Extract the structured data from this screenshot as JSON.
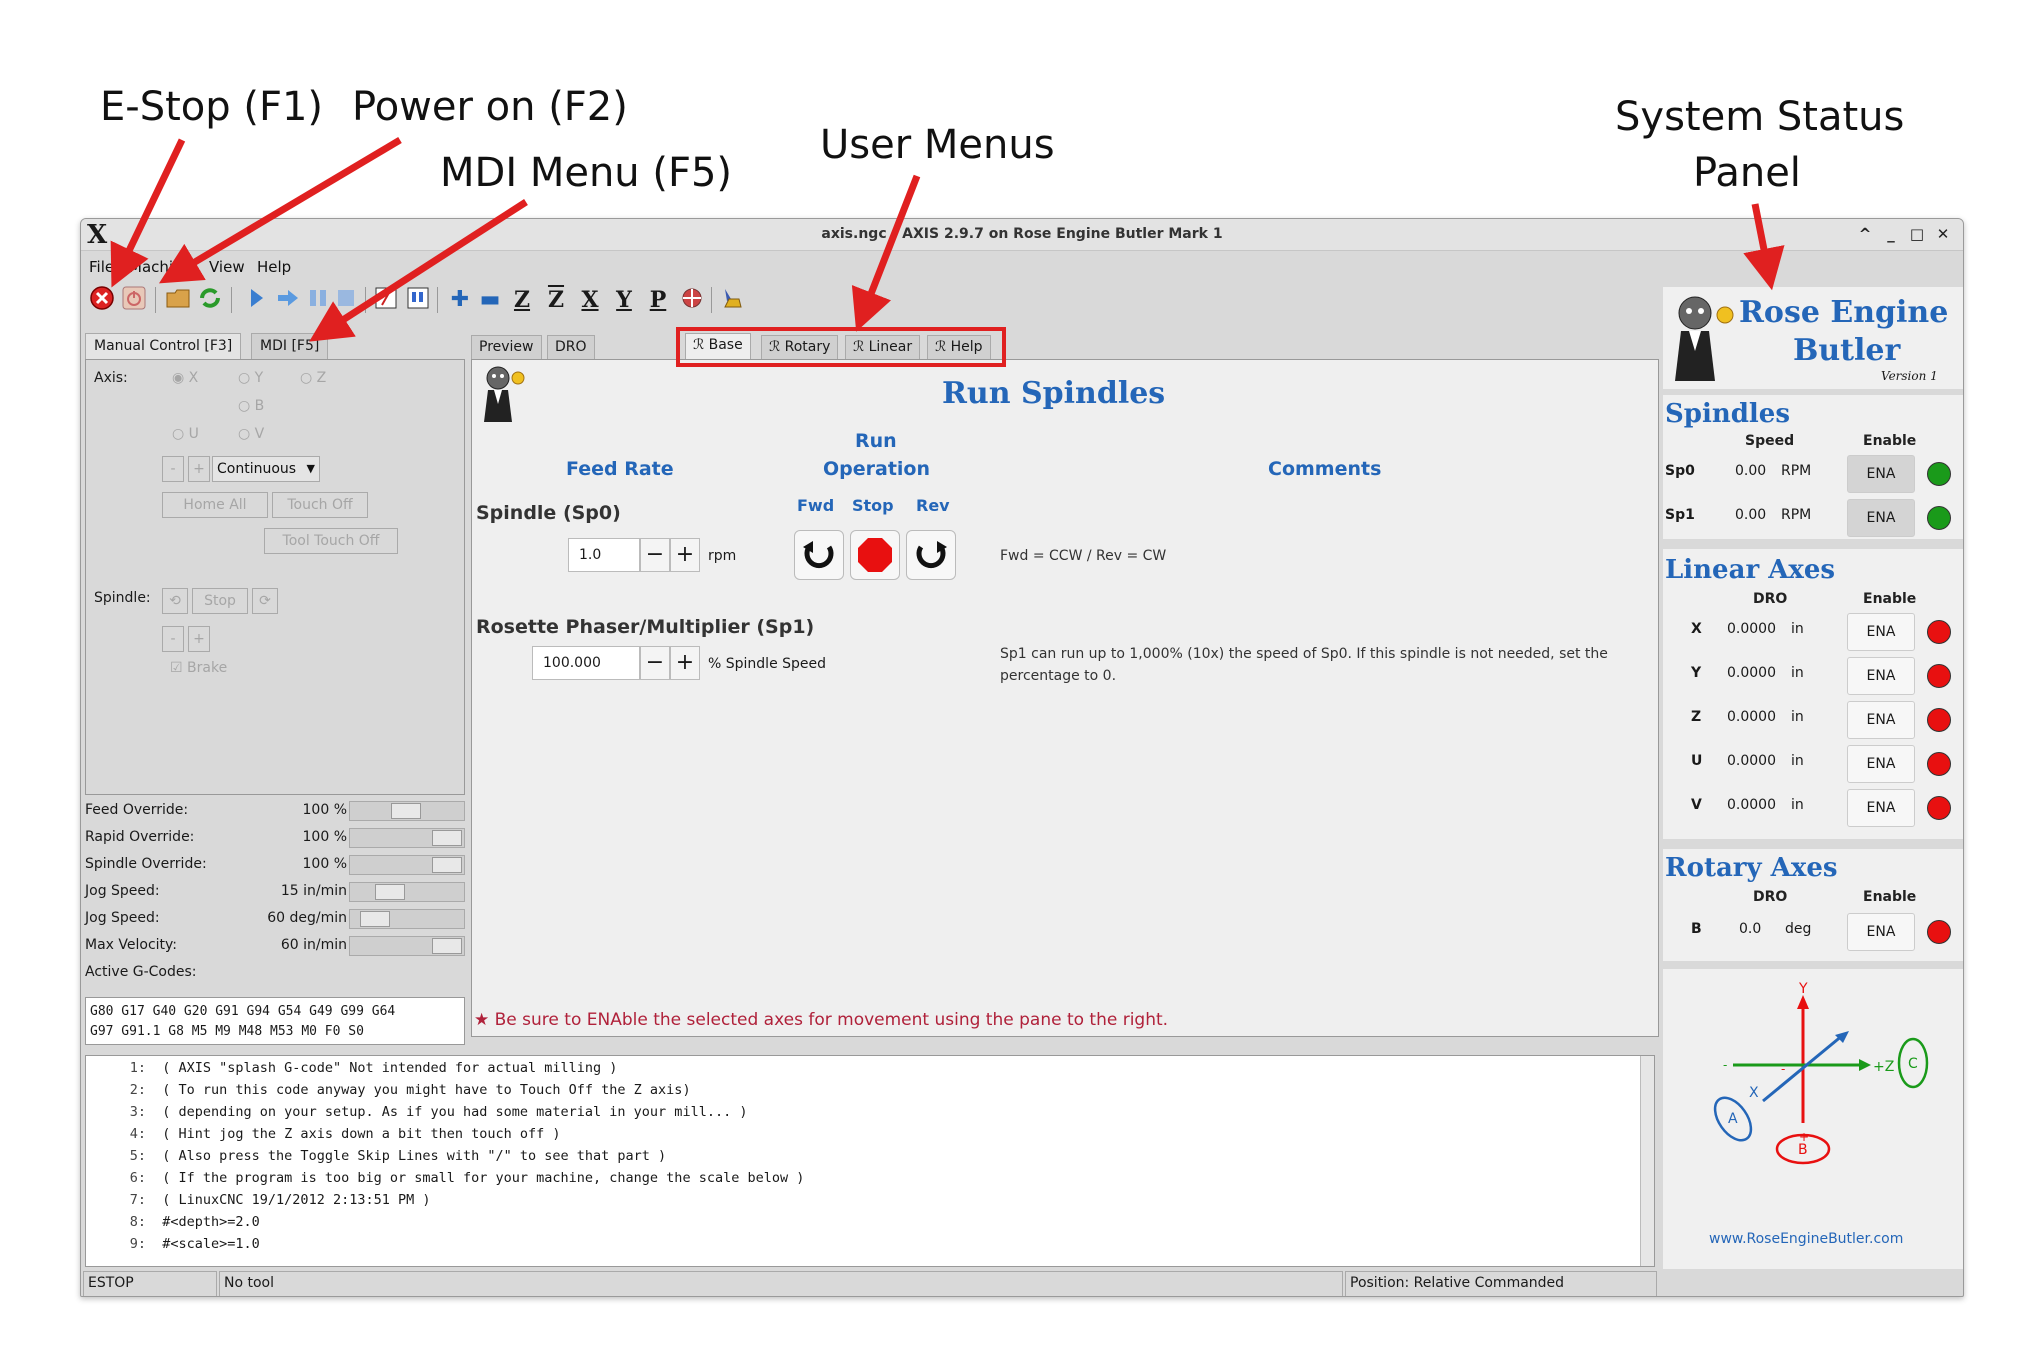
{
  "callouts": {
    "estop": "E-Stop (F1)",
    "power": "Power on (F2)",
    "mdi": "MDI Menu (F5)",
    "user_menus": "User Menus",
    "status_line1": "System Status",
    "status_line2": "Panel"
  },
  "window": {
    "title": "axis.ngc - AXIS 2.9.7 on Rose Engine Butler Mark 1",
    "logo": "X",
    "controls": [
      "^",
      "_",
      "□",
      "✕"
    ]
  },
  "menu": [
    "File",
    "Machine",
    "View",
    "Help"
  ],
  "toolbar_icons": [
    "estop-icon",
    "power-icon",
    "open-file-icon",
    "reload-icon",
    "run-icon",
    "step-icon",
    "pause-icon",
    "stop-icon",
    "block-delete-icon",
    "optional-stop-icon",
    "zoom-in-icon",
    "zoom-out-icon",
    "view-z-icon",
    "view-z2-icon",
    "view-x-icon",
    "view-y-icon",
    "view-p-icon",
    "rotate-view-icon",
    "clear-plot-icon"
  ],
  "left_tabs": [
    "Manual Control [F3]",
    "MDI [F5]"
  ],
  "manual": {
    "axis_label": "Axis:",
    "axes": [
      "X",
      "Y",
      "Z",
      "B",
      "U",
      "V"
    ],
    "minus": "-",
    "plus": "+",
    "jog_mode": "Continuous",
    "home_all": "Home All",
    "touch_off": "Touch Off",
    "tool_touch_off": "Tool Touch Off",
    "spindle_label": "Spindle:",
    "stop": "Stop",
    "brake": "Brake"
  },
  "overrides": [
    {
      "name": "Feed Override:",
      "value": "100 %",
      "level": 0.5
    },
    {
      "name": "Rapid Override:",
      "value": "100 %",
      "level": 1.0
    },
    {
      "name": "Spindle Override:",
      "value": "100 %",
      "level": 1.0
    },
    {
      "name": "Jog Speed:",
      "value": "15 in/min",
      "level": 0.3
    },
    {
      "name": "Jog Speed:",
      "value": "60 deg/min",
      "level": 0.12
    },
    {
      "name": "Max Velocity:",
      "value": "60 in/min",
      "level": 1.0
    }
  ],
  "active_gcodes": {
    "label": "Active G-Codes:",
    "line1": "G80 G17 G40 G20 G91 G94 G54 G49 G99 G64",
    "line2": "G97 G91.1 G8 M5 M9 M48 M53 M0 F0 S0"
  },
  "center_tabs": [
    "Preview",
    "DRO",
    "ℛ Base",
    "ℛ Rotary",
    "ℛ Linear",
    "ℛ Help"
  ],
  "spindles_page": {
    "title": "Run Spindles",
    "col_feed": "Feed Rate",
    "col_run1": "Run",
    "col_run2": "Operation",
    "col_comments": "Comments",
    "fwd": "Fwd",
    "stop": "Stop",
    "rev": "Rev",
    "sp0_label": "Spindle (Sp0)",
    "sp0_value": "1.0",
    "sp0_unit": "rpm",
    "sp0_comment": "Fwd = CCW / Rev = CW",
    "sp1_label": "Rosette Phaser/Multiplier (Sp1)",
    "sp1_value": "100.000",
    "sp1_unit": "% Spindle Speed",
    "sp1_comment1": "Sp1 can run up to 1,000% (10x) the speed of Sp0.  If this spindle is not needed, set the",
    "sp1_comment2": "percentage to 0.",
    "minus": "−",
    "plus": "+",
    "footer": "★ Be sure to ENAble the selected axes for movement using the pane to the right."
  },
  "console": [
    {
      "n": "1:",
      "t": "( AXIS \"splash G-code\" Not intended for actual milling )"
    },
    {
      "n": "2:",
      "t": "( To run this code anyway you might have to Touch Off the Z axis)"
    },
    {
      "n": "3:",
      "t": "( depending on your setup. As if you had some material in your mill... )"
    },
    {
      "n": "4:",
      "t": "( Hint jog the Z axis down a bit then touch off )"
    },
    {
      "n": "5:",
      "t": "( Also press the Toggle Skip Lines with \"/\" to see that part )"
    },
    {
      "n": "6:",
      "t": "( If the program is too big or small for your machine, change the scale below )"
    },
    {
      "n": "7:",
      "t": "( LinuxCNC 19/1/2012 2:13:51 PM )"
    },
    {
      "n": "8:",
      "t": "#<depth>=2.0"
    },
    {
      "n": "9:",
      "t": "#<scale>=1.0"
    }
  ],
  "status": {
    "estop": "ESTOP",
    "tool": "No tool",
    "position": "Position: Relative Commanded"
  },
  "panel": {
    "brand1": "Rose Engine",
    "brand2": "Butler",
    "version": "Version 1",
    "spindles": {
      "title": "Spindles",
      "col_speed": "Speed",
      "col_enable": "Enable",
      "rows": [
        {
          "name": "Sp0",
          "value": "0.00",
          "unit": "RPM",
          "ena": "ENA",
          "led": "#1a9a1a"
        },
        {
          "name": "Sp1",
          "value": "0.00",
          "unit": "RPM",
          "ena": "ENA",
          "led": "#1a9a1a"
        }
      ]
    },
    "linear": {
      "title": "Linear Axes",
      "col_dro": "DRO",
      "col_enable": "Enable",
      "rows": [
        {
          "name": "X",
          "value": "0.0000",
          "unit": "in",
          "ena": "ENA",
          "led": "#e81010"
        },
        {
          "name": "Y",
          "value": "0.0000",
          "unit": "in",
          "ena": "ENA",
          "led": "#e81010"
        },
        {
          "name": "Z",
          "value": "0.0000",
          "unit": "in",
          "ena": "ENA",
          "led": "#e81010"
        },
        {
          "name": "U",
          "value": "0.0000",
          "unit": "in",
          "ena": "ENA",
          "led": "#e81010"
        },
        {
          "name": "V",
          "value": "0.0000",
          "unit": "in",
          "ena": "ENA",
          "led": "#e81010"
        }
      ]
    },
    "rotary": {
      "title": "Rotary Axes",
      "col_dro": "DRO",
      "col_enable": "Enable",
      "rows": [
        {
          "name": "B",
          "value": "0.0",
          "unit": "deg",
          "ena": "ENA",
          "led": "#e81010"
        }
      ]
    },
    "diagram": {
      "y": "Y",
      "x": "X",
      "z": "+Z",
      "a": "A",
      "b": "B",
      "c": "C",
      "minus": "-",
      "plus": "+"
    },
    "url": "www.RoseEngineButler.com"
  },
  "colors": {
    "accent": "#2466b8",
    "callout_red": "#e02020",
    "led_green": "#1a9a1a",
    "led_red": "#e81010",
    "footer_red": "#b0213a"
  }
}
